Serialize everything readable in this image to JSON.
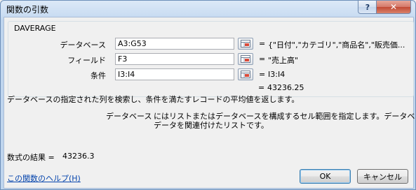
{
  "window": {
    "title": "関数の引数",
    "help_label": "?",
    "close_label": "✕"
  },
  "function_name": "DAVERAGE",
  "arguments": [
    {
      "label": "データベース",
      "value": "A3:G53",
      "result": "{\"日付\",\"カテゴリ\",\"商品名\",\"販売価..."
    },
    {
      "label": "フィールド",
      "value": "F3",
      "result": "\"売上高\""
    },
    {
      "label": "条件",
      "value": "I3:I4",
      "result": "I3:I4"
    }
  ],
  "equals_sign": "=",
  "function_result": "43236.25",
  "function_description": "データベースの指定された列を検索し、条件を満たすレコードの平均値を返します。",
  "argument_help": {
    "name": "データベース",
    "line1": "にはリストまたはデータベースを構成するセル範囲を指定します。データベースは",
    "line2": "データを関連付けたリストです。"
  },
  "formula_result_label": "数式の結果 =",
  "formula_result_value": "43236.3",
  "help_link": "この関数のヘルプ(H)",
  "buttons": {
    "ok": "OK",
    "cancel": "キャンセル"
  }
}
